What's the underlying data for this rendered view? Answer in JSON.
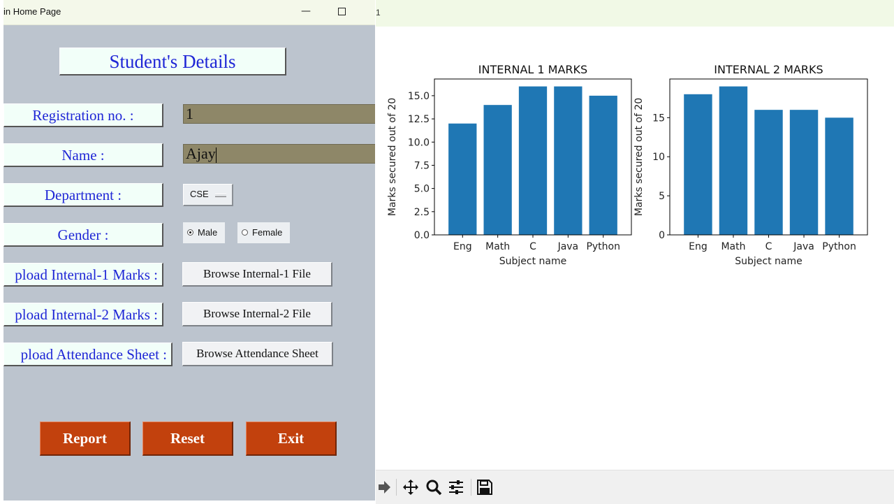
{
  "left_window": {
    "title": "in Home Page",
    "controls": {
      "minimize": "—",
      "close": "✕"
    }
  },
  "form": {
    "heading": "Student's Details",
    "labels": {
      "registration": "Registration no. :",
      "name": "Name :",
      "department": "Department :",
      "gender": "Gender :",
      "upload1": "pload Internal-1 Marks :",
      "upload2": "pload Internal-2 Marks :",
      "upload_att": "pload Attendance Sheet :"
    },
    "values": {
      "registration": "1",
      "name": "Ajay"
    },
    "department_selected": "CSE",
    "gender_options": [
      "Male",
      "Female"
    ],
    "gender_selected": "Male",
    "browse": {
      "internal1": "Browse Internal-1 File",
      "internal2": "Browse Internal-2 File",
      "attendance": "Browse Attendance Sheet"
    },
    "actions": {
      "report": "Report",
      "reset": "Reset",
      "exit": "Exit"
    }
  },
  "right_window": {
    "title": "1",
    "toolbar_icons": [
      "forward-icon",
      "pan-icon",
      "zoom-icon",
      "configure-subplots-icon",
      "save-icon"
    ]
  },
  "colors": {
    "bar": "#1f77b4",
    "label_text": "#1f26d6",
    "action_button": "#c2410d",
    "entry_bg": "#8e8768",
    "panel_bg": "#bcc4ce"
  },
  "chart_data": [
    {
      "type": "bar",
      "title": "INTERNAL 1 MARKS",
      "xlabel": "Subject name",
      "ylabel": "Marks secured out of 20",
      "categories": [
        "Eng",
        "Math",
        "C",
        "Java",
        "Python"
      ],
      "values": [
        12,
        14,
        16,
        16,
        15
      ],
      "ylim": [
        0,
        16.8
      ],
      "yticks": [
        "0.0",
        "2.5",
        "5.0",
        "7.5",
        "10.0",
        "12.5",
        "15.0"
      ],
      "ytick_values": [
        0,
        2.5,
        5,
        7.5,
        10,
        12.5,
        15
      ],
      "grid": false
    },
    {
      "type": "bar",
      "title": "INTERNAL 2 MARKS",
      "xlabel": "Subject name",
      "ylabel": "Marks secured out of 20",
      "categories": [
        "Eng",
        "Math",
        "C",
        "Java",
        "Python"
      ],
      "values": [
        18,
        19,
        16,
        16,
        15
      ],
      "ylim": [
        0,
        19.95
      ],
      "yticks": [
        "0",
        "5",
        "10",
        "15"
      ],
      "ytick_values": [
        0,
        5,
        10,
        15
      ],
      "grid": false
    }
  ]
}
